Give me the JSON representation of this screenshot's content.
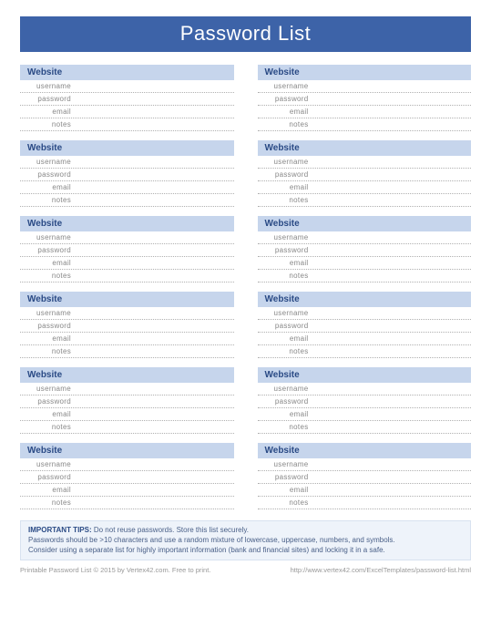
{
  "title": "Password List",
  "entry_header": "Website",
  "field_labels": {
    "username": "username",
    "password": "password",
    "email": "email",
    "notes": "notes"
  },
  "columns": [
    [
      {
        "username": "",
        "password": "",
        "email": "",
        "notes": ""
      },
      {
        "username": "",
        "password": "",
        "email": "",
        "notes": ""
      },
      {
        "username": "",
        "password": "",
        "email": "",
        "notes": ""
      },
      {
        "username": "",
        "password": "",
        "email": "",
        "notes": ""
      },
      {
        "username": "",
        "password": "",
        "email": "",
        "notes": ""
      },
      {
        "username": "",
        "password": "",
        "email": "",
        "notes": ""
      }
    ],
    [
      {
        "username": "",
        "password": "",
        "email": "",
        "notes": ""
      },
      {
        "username": "",
        "password": "",
        "email": "",
        "notes": ""
      },
      {
        "username": "",
        "password": "",
        "email": "",
        "notes": ""
      },
      {
        "username": "",
        "password": "",
        "email": "",
        "notes": ""
      },
      {
        "username": "",
        "password": "",
        "email": "",
        "notes": ""
      },
      {
        "username": "",
        "password": "",
        "email": "",
        "notes": ""
      }
    ]
  ],
  "tips": {
    "title": "IMPORTANT TIPS:",
    "line1": "Do not reuse passwords. Store this list securely.",
    "line2": "Passwords should be >10 characters and use a random mixture of lowercase, uppercase, numbers, and symbols.",
    "line3": "Consider using a separate list for highly important information (bank and financial sites) and locking it in a safe."
  },
  "footer": {
    "left": "Printable Password List © 2015 by Vertex42.com. Free to print.",
    "right": "http://www.vertex42.com/ExcelTemplates/password-list.html"
  }
}
